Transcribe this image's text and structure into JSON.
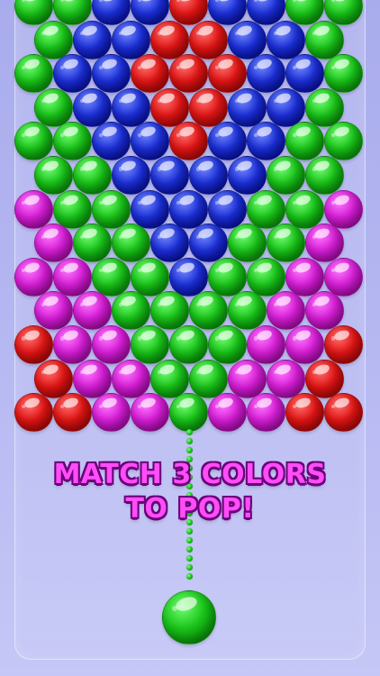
{
  "colors": {
    "green": "#19c219",
    "blue": "#1b2fd6",
    "red": "#e01515",
    "magenta": "#d61ed6"
  },
  "bubble_grid": {
    "rows": [
      [
        "green",
        "green",
        "blue",
        "blue",
        "red",
        "blue",
        "blue",
        "green",
        "green"
      ],
      [
        "green",
        "blue",
        "blue",
        "red",
        "red",
        "blue",
        "blue",
        "green"
      ],
      [
        "green",
        "blue",
        "blue",
        "red",
        "red",
        "red",
        "blue",
        "blue",
        "green"
      ],
      [
        "green",
        "blue",
        "blue",
        "red",
        "red",
        "blue",
        "blue",
        "green"
      ],
      [
        "green",
        "green",
        "blue",
        "blue",
        "red",
        "blue",
        "blue",
        "green",
        "green"
      ],
      [
        "green",
        "green",
        "blue",
        "blue",
        "blue",
        "blue",
        "green",
        "green"
      ],
      [
        "magenta",
        "green",
        "green",
        "blue",
        "blue",
        "blue",
        "green",
        "green",
        "magenta"
      ],
      [
        "magenta",
        "green",
        "green",
        "blue",
        "blue",
        "green",
        "green",
        "magenta"
      ],
      [
        "magenta",
        "magenta",
        "green",
        "green",
        "blue",
        "green",
        "green",
        "magenta",
        "magenta"
      ],
      [
        "magenta",
        "magenta",
        "green",
        "green",
        "green",
        "green",
        "magenta",
        "magenta"
      ],
      [
        "red",
        "magenta",
        "magenta",
        "green",
        "green",
        "green",
        "magenta",
        "magenta",
        "red"
      ],
      [
        "red",
        "magenta",
        "magenta",
        "green",
        "green",
        "magenta",
        "magenta",
        "red"
      ],
      [
        "red",
        "red",
        "magenta",
        "magenta",
        "green",
        "magenta",
        "magenta",
        "red",
        "red"
      ]
    ]
  },
  "instruction": {
    "line1": "MATCH 3 COLORS",
    "line2": "TO POP!"
  },
  "shooter": {
    "color": "green"
  }
}
